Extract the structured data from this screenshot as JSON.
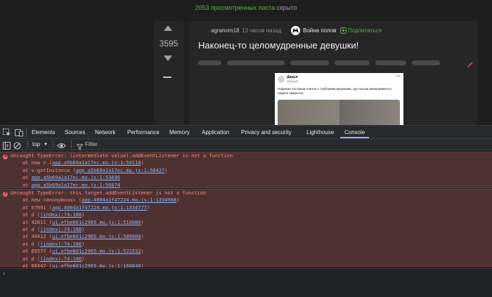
{
  "page": {
    "hidden_count": "2053 просмотренных поста",
    "hidden_suffix": "скрыто",
    "vote_score": "3595",
    "post": {
      "author": "agranom18",
      "time": "13 часов назад",
      "community": "Война полов",
      "subscribe": "Подписаться",
      "title": "Наконец-то целомудренные девушки!"
    },
    "tweet": {
      "name": "Дарья",
      "handle": "@daryy6",
      "text": "Надевли эти ваши платья с глубокими вырезами, где сиськи вываливаются, надела закрытое"
    }
  },
  "devtools": {
    "tabs": [
      "Elements",
      "Sources",
      "Network",
      "Performance",
      "Memory",
      "Application",
      "Privacy and security",
      "Lighthouse",
      "Console"
    ],
    "active_tab": "Console",
    "context": "top",
    "filter_placeholder": "Filter",
    "errors": [
      {
        "message": "Uncaught TypeError: (intermediate value).addEventListener is not a function",
        "frames": [
          {
            "prefix": "    at new v (",
            "link": "app.a5b69a1a17ec.mo.js:1:50118",
            "suffix": ")"
          },
          {
            "prefix": "    at v.getInstance (",
            "link": "app.a5b69a1a17ec.mo.js:1:50427",
            "suffix": ")"
          },
          {
            "prefix": "    at ",
            "link": "app.a5b69a1a17ec.mo.js:1:53696",
            "suffix": ""
          },
          {
            "prefix": "    at ",
            "link": "app.a5b69a1a17ec.mo.js:1:56674",
            "suffix": ""
          }
        ]
      },
      {
        "message": "Uncaught TypeError: this.target.addEventListener is not a function",
        "frames": [
          {
            "prefix": "    at new <anonymous> (",
            "link": "app.4004a1f47224.mo.js:1:1334908",
            "suffix": ")"
          },
          {
            "prefix": "    at 97091 (",
            "link": "app.4004a1f47224.mo.js:1:1334777",
            "suffix": ")"
          },
          {
            "prefix": "    at d (",
            "link": "(index):74:186",
            "suffix": ")"
          },
          {
            "prefix": "    at 42011 (",
            "link": "ui.efbe601c2965.mo.js:1:510080",
            "suffix": ")"
          },
          {
            "prefix": "    at d (",
            "link": "(index):74:186",
            "suffix": ")"
          },
          {
            "prefix": "    at 49412 (",
            "link": "ui.efbe601c2965.mo.js:1:509900",
            "suffix": ")"
          },
          {
            "prefix": "    at d (",
            "link": "(index):74:186",
            "suffix": ")"
          },
          {
            "prefix": "    at 65577 (",
            "link": "ui.efbe601c2965.mo.js:1:521532",
            "suffix": ")"
          },
          {
            "prefix": "    at d (",
            "link": "(index):74:186",
            "suffix": ")"
          },
          {
            "prefix": "    at 66447 (",
            "link": "ui.efbe601c2965.mo.js:1:168840",
            "suffix": ")"
          }
        ]
      }
    ],
    "prompt_symbol": "›"
  },
  "colors": {
    "accent": "#8ab4f8",
    "error_text": "#f28b82",
    "error_bg": "#4e3131",
    "green": "#5fae4a"
  }
}
